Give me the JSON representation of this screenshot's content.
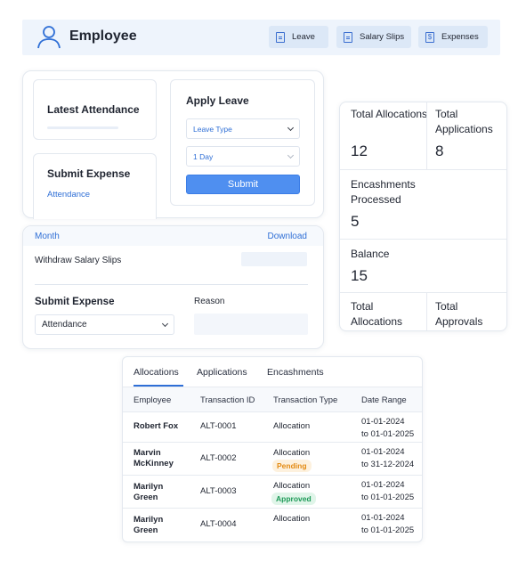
{
  "header": {
    "title": "Employee",
    "buttons": [
      "Leave",
      "Salary Slips",
      "Expenses"
    ]
  },
  "cards": {
    "latest_attendance": "Latest Attendance",
    "submit_expense": "Submit Expense",
    "attendance_link": "Attendance"
  },
  "apply_leave": {
    "title": "Apply Leave",
    "leave_type": "Leave Type",
    "duration": "1 Day",
    "submit": "Submit"
  },
  "salary": {
    "month": "Month",
    "download": "Download",
    "row_label": "Withdraw Salary Slips",
    "expense_title": "Submit Expense",
    "expense_select": "Attendance",
    "reason_label": "Reason"
  },
  "stats": {
    "total_allocations_label": "Total Allocations",
    "total_allocations": "12",
    "total_applications_label": "Total Applications",
    "total_applications": "8",
    "encashments_label": "Encashments Processed",
    "encashments": "5",
    "balance_label": "Balance",
    "balance": "15",
    "bottom_left_label": "Total Allocations",
    "bottom_right_label": "Total Approvals"
  },
  "table": {
    "tabs": [
      "Allocations",
      "Applications",
      "Encashments"
    ],
    "active_tab": "Allocations",
    "columns": [
      "Employee",
      "Transaction ID",
      "Transaction Type",
      "Date Range"
    ],
    "rows": [
      {
        "employee": "Robert Fox",
        "id": "ALT-0001",
        "type": "Allocation",
        "badge": "",
        "from": "01-01-2024",
        "to": "to 01-01-2025"
      },
      {
        "employee": "Marvin McKinney",
        "id": "ALT-0002",
        "type": "Allocation",
        "badge": "Pending",
        "from": "01-01-2024",
        "to": "to 31-12-2024"
      },
      {
        "employee": "Marilyn Green",
        "id": "ALT-0003",
        "type": "Allocation",
        "badge": "Approved",
        "from": "01-01-2024",
        "to": "to 01-01-2025"
      },
      {
        "employee": "Marilyn Green",
        "id": "ALT-0004",
        "type": "Allocation",
        "badge": "",
        "from": "01-01-2024",
        "to": "to 01-01-2025"
      }
    ]
  },
  "colors": {
    "accent": "#2f6fd6",
    "submit_button": "#4f8ff0",
    "header_bg": "#eef4fc",
    "pending_text": "#e38a12",
    "pending_bg": "#fdf1de",
    "approved_text": "#1e9a58",
    "approved_bg": "#e0f5e9"
  }
}
